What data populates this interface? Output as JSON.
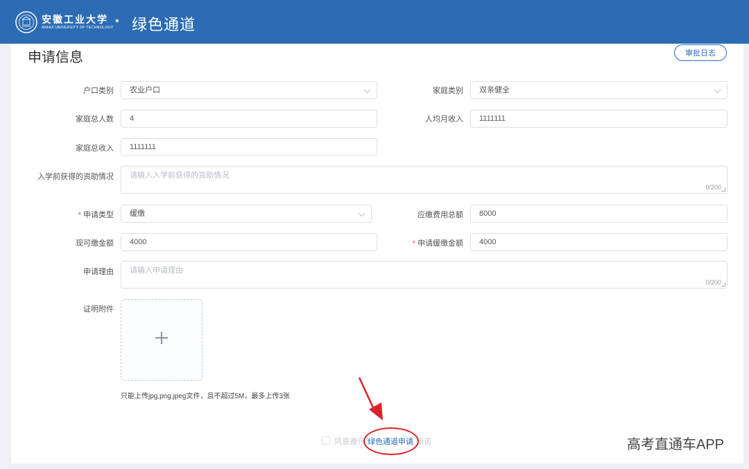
{
  "header": {
    "university_cn": "安徽工业大学",
    "university_en": "ANHUI UNIVERSITY OF TECHNOLOGY",
    "separator": "•",
    "title": "绿色通道"
  },
  "section": {
    "title": "申请信息",
    "audit_log_button": "审批日志"
  },
  "form": {
    "hukou_type": {
      "label": "户口类别",
      "value": "农业户口"
    },
    "family_type": {
      "label": "家庭类别",
      "value": "双亲健全"
    },
    "family_size": {
      "label": "家庭总人数",
      "value": "4"
    },
    "per_capita_income": {
      "label": "人均月收入",
      "value": "1111111"
    },
    "family_income": {
      "label": "家庭总收入",
      "value": "1111111"
    },
    "prior_aid": {
      "label": "入学前获得的资助情况",
      "placeholder": "请输入入学前获得的资助情况",
      "counter": "0/200"
    },
    "apply_type": {
      "label": "申请类型",
      "value": "缓缴"
    },
    "total_fee": {
      "label": "应缴费用总额",
      "value": "8000"
    },
    "payable_now": {
      "label": "现可缴金额",
      "value": "4000"
    },
    "deferred_amount": {
      "label": "申请缓缴金额",
      "value": "4000"
    },
    "reason": {
      "label": "申请理由",
      "placeholder": "请输入申请理由",
      "counter": "0/200"
    },
    "attachment": {
      "label": "证明附件",
      "hint": "只能上传jpg,png,jpeg文件，且不超过5M，最多上传3张"
    },
    "required_mark": "*"
  },
  "footer": {
    "agree_prefix": "同意遵守",
    "apply_link": "绿色通道申请",
    "agree_suffix": "承诺"
  },
  "watermark": "高考直通车APP",
  "colors": {
    "brand_blue": "#2c6cb4",
    "annotation_red": "#e0202a",
    "required_red": "#e54b4b"
  }
}
